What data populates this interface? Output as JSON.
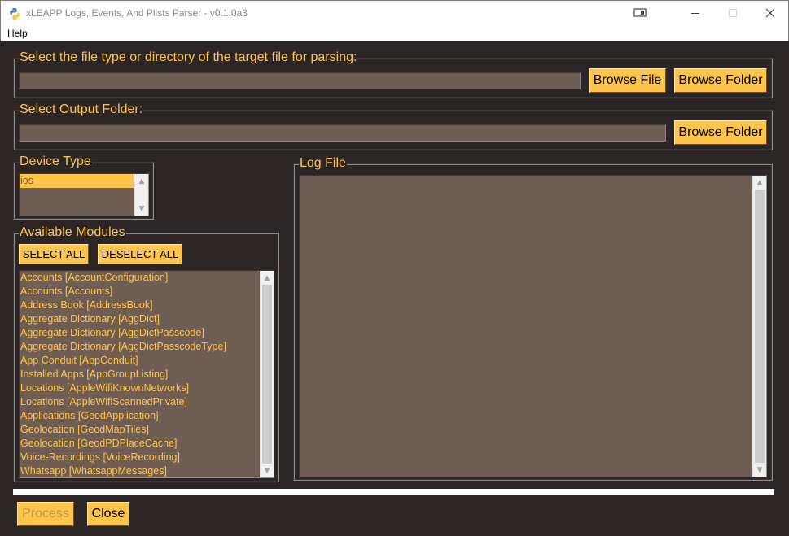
{
  "window": {
    "title": "xLEAPP Logs, Events, And Plists Parser - v0.1.0a3",
    "icons": [
      "python-icon",
      "restore-layout-icon",
      "minimize-icon",
      "maximize-icon",
      "close-icon"
    ]
  },
  "menu": {
    "items": [
      "Help"
    ]
  },
  "input_section": {
    "legend": "Select the file type or directory of the target file for parsing:",
    "path_value": "",
    "browse_file_label": "Browse File",
    "browse_folder_label": "Browse Folder"
  },
  "output_section": {
    "legend": "Select Output Folder:",
    "path_value": "",
    "browse_folder_label": "Browse Folder"
  },
  "device_type": {
    "legend": "Device Type",
    "options": [
      "ios"
    ],
    "selected": "ios"
  },
  "modules": {
    "legend": "Available Modules",
    "select_all_label": "SELECT ALL",
    "deselect_all_label": "DESELECT ALL",
    "items": [
      "Accounts [AccountConfiguration]",
      "Accounts [Accounts]",
      "Address Book [AddressBook]",
      "Aggregate Dictionary [AggDict]",
      "Aggregate Dictionary [AggDictPasscode]",
      "Aggregate Dictionary [AggDictPasscodeType]",
      "App Conduit [AppConduit]",
      "Installed Apps [AppGroupListing]",
      "Locations [AppleWifiKnownNetworks]",
      "Locations [AppleWifiScannedPrivate]",
      "Applications [GeodApplication]",
      "Geolocation [GeodMapTiles]",
      "Geolocation [GeodPDPlaceCache]",
      "Voice-Recordings [VoiceRecording]",
      "Whatsapp [WhatsappMessages]"
    ]
  },
  "log": {
    "legend": "Log File",
    "content": ""
  },
  "progress": {
    "value": 0
  },
  "actions": {
    "process_label": "Process",
    "close_label": "Close"
  },
  "colors": {
    "background": "#2b2625",
    "accent": "#ffc54a",
    "field": "#6e5d52"
  }
}
